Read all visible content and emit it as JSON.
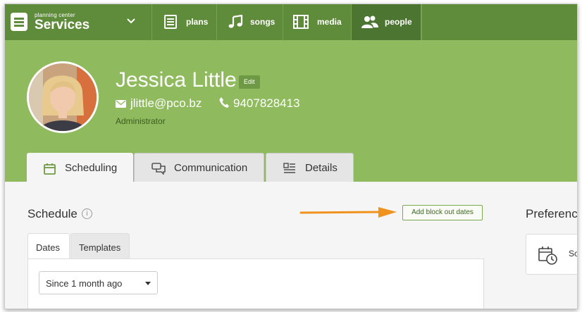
{
  "brand": {
    "small": "planning center",
    "name": "Services"
  },
  "nav": [
    {
      "label": "plans",
      "icon": "plans-icon"
    },
    {
      "label": "songs",
      "icon": "music-note-icon"
    },
    {
      "label": "media",
      "icon": "film-icon"
    },
    {
      "label": "people",
      "icon": "people-icon",
      "active": true
    }
  ],
  "profile": {
    "name": "Jessica Little",
    "edit_label": "Edit",
    "email": "jlittle@pco.bz",
    "phone": "9407828413",
    "role": "Administrator"
  },
  "tabs": [
    {
      "label": "Scheduling",
      "icon": "calendar-icon",
      "active": true
    },
    {
      "label": "Communication",
      "icon": "chat-icon"
    },
    {
      "label": "Details",
      "icon": "details-icon"
    }
  ],
  "schedule": {
    "title": "Schedule",
    "info_glyph": "i",
    "add_button": "Add block out dates",
    "subtabs": [
      "Dates",
      "Templates"
    ],
    "filter_value": "Since 1 month ago"
  },
  "preferences": {
    "title": "Preferences",
    "item_label": "Sc"
  },
  "colors": {
    "nav_bg": "#5f8c3a",
    "header_bg": "#8fbb5e",
    "accent": "#3d6b1f",
    "arrow": "#f0921e"
  }
}
